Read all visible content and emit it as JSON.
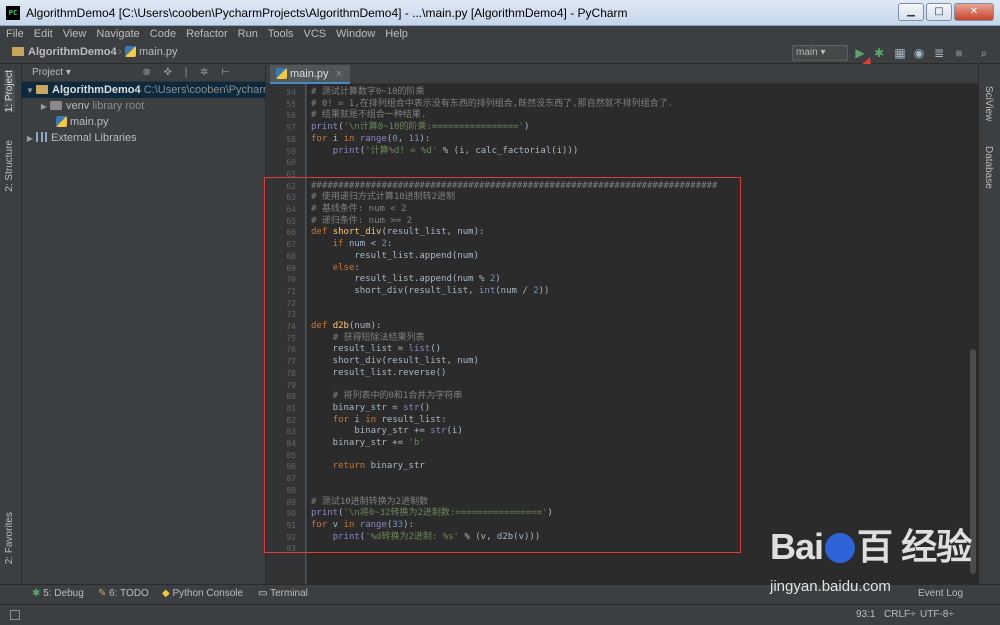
{
  "window": {
    "title": "AlgorithmDemo4 [C:\\Users\\cooben\\PycharmProjects\\AlgorithmDemo4] - ...\\main.py [AlgorithmDemo4] - PyCharm",
    "app_icon": "PC",
    "minimize": "▁",
    "maximize": "□",
    "close": "✕"
  },
  "menu": [
    "File",
    "Edit",
    "View",
    "Navigate",
    "Code",
    "Refactor",
    "Run",
    "Tools",
    "VCS",
    "Window",
    "Help"
  ],
  "nav": {
    "project": "AlgorithmDemo4",
    "file": "main.py",
    "run_config": "main ▾"
  },
  "toolbar_icons": [
    "run-icon",
    "debug-icon",
    "coverage-icon",
    "profile-icon",
    "build-icon",
    "stop-icon"
  ],
  "left_tabs": {
    "project": "1: Project",
    "structure": "2: Structure",
    "favorites": "2: Favorites"
  },
  "project_panel": {
    "header": "Project ▾",
    "tools": "⊗ ✜ | ✲ ⊢",
    "root": {
      "name": "AlgorithmDemo4",
      "path": "C:\\Users\\cooben\\PycharmProjects\\AlgorithmDemo4"
    },
    "venv": {
      "name": "venv",
      "note": "library root"
    },
    "file": "main.py",
    "libs": "External Libraries"
  },
  "editor": {
    "tab": "main.py",
    "close": "×",
    "lines": [
      {
        "n": "54",
        "text": "# 测试计算数字0~10的阶乘"
      },
      {
        "n": "55",
        "text": "# 0! = 1,在排列组合中表示没有东西的排列组合,既然没东西了,那自然就不排列组合了."
      },
      {
        "n": "56",
        "text": "# 结果就是不组合一种结果."
      },
      {
        "n": "57",
        "text": "print('\\n计算0~10的阶乘:================')"
      },
      {
        "n": "58",
        "text": "for i in range(0, 11):"
      },
      {
        "n": "59",
        "text": "    print('计算%d! = %d' % (i, calc_factorial(i)))"
      },
      {
        "n": "60",
        "text": ""
      },
      {
        "n": "61",
        "text": ""
      },
      {
        "n": "62",
        "text": "###########################################################################"
      },
      {
        "n": "63",
        "text": "# 使用递归方式计算10进制转2进制"
      },
      {
        "n": "64",
        "text": "# 基线条件: num < 2"
      },
      {
        "n": "65",
        "text": "# 递归条件: num >= 2"
      },
      {
        "n": "66",
        "text": "def short_div(result_list, num):"
      },
      {
        "n": "67",
        "text": "    if num < 2:"
      },
      {
        "n": "68",
        "text": "        result_list.append(num)"
      },
      {
        "n": "69",
        "text": "    else:"
      },
      {
        "n": "70",
        "text": "        result_list.append(num % 2)"
      },
      {
        "n": "71",
        "text": "        short_div(result_list, int(num / 2))"
      },
      {
        "n": "72",
        "text": ""
      },
      {
        "n": "73",
        "text": ""
      },
      {
        "n": "74",
        "text": "def d2b(num):"
      },
      {
        "n": "75",
        "text": "    # 获得短除法结果列表"
      },
      {
        "n": "76",
        "text": "    result_list = list()"
      },
      {
        "n": "77",
        "text": "    short_div(result_list, num)"
      },
      {
        "n": "78",
        "text": "    result_list.reverse()"
      },
      {
        "n": "79",
        "text": ""
      },
      {
        "n": "80",
        "text": "    # 将列表中的0和1合并为字符串"
      },
      {
        "n": "81",
        "text": "    binary_str = str()"
      },
      {
        "n": "82",
        "text": "    for i in result_list:"
      },
      {
        "n": "83",
        "text": "        binary_str += str(i)"
      },
      {
        "n": "84",
        "text": "    binary_str += 'b'"
      },
      {
        "n": "85",
        "text": ""
      },
      {
        "n": "86",
        "text": "    return binary_str"
      },
      {
        "n": "87",
        "text": ""
      },
      {
        "n": "88",
        "text": ""
      },
      {
        "n": "89",
        "text": "# 测试10进制转换为2进制数"
      },
      {
        "n": "90",
        "text": "print('\\n将0~32转换为2进制数:================')"
      },
      {
        "n": "91",
        "text": "for v in range(33):"
      },
      {
        "n": "92",
        "text": "    print('%d转换为2进制: %s' % (v, d2b(v)))"
      },
      {
        "n": "93",
        "text": ""
      }
    ]
  },
  "right_tabs": {
    "sciview": "SciView",
    "database": "Database"
  },
  "bottom_tools": [
    {
      "key": "debug",
      "label": "5: Debug"
    },
    {
      "key": "todo",
      "label": "6: TODO"
    },
    {
      "key": "console",
      "label": "Python Console"
    },
    {
      "key": "terminal",
      "label": "Terminal"
    },
    {
      "key": "eventlog",
      "label": "Event Log"
    }
  ],
  "status": {
    "position": "93:1",
    "line_sep": "CRLF÷",
    "encoding": "UTF-8÷"
  },
  "watermark": {
    "logo": "Bai",
    "logo2": "百",
    "cn": "经验",
    "url": "jingyan.baidu.com"
  },
  "colors": {
    "accent": "#4a88c7",
    "annotation": "#e23b3b",
    "run": "#59a869",
    "debug": "#59a869"
  }
}
